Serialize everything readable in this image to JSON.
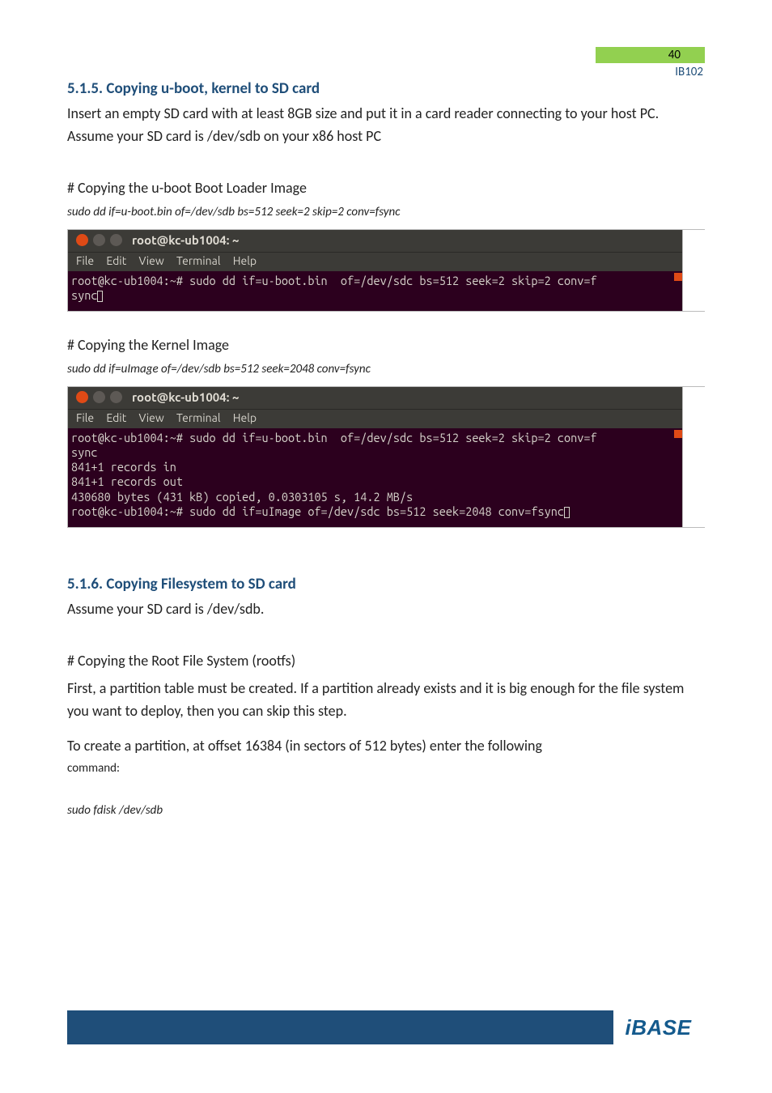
{
  "header": {
    "page_number": "40",
    "model": "IB102"
  },
  "section515": {
    "heading": "5.1.5. Copying u-boot, kernel to SD card",
    "intro": "Insert an empty SD card with at least 8GB size and put it in a card reader connecting to your host PC. Assume your SD card is /dev/sdb on your x86 host PC",
    "sub1_title": "# Copying the u-boot Boot Loader Image",
    "sub1_cmd": "sudo dd if=u-boot.bin    of=/dev/sdb bs=512 seek=2 skip=2 conv=fsync",
    "sub2_title": "# Copying the Kernel Image",
    "sub2_cmd": "sudo dd if=uImage of=/dev/sdb bs=512 seek=2048 conv=fsync"
  },
  "terminal1": {
    "title": "root@kc-ub1004: ~",
    "menu": {
      "file": "File",
      "edit": "Edit",
      "view": "View",
      "terminal": "Terminal",
      "help": "Help"
    },
    "lines": {
      "l1a": "root@kc-ub1004:~# sudo dd if=u-boot.bin  of=/dev/sdc bs=512 seek=2 skip=2 conv=f",
      "l2": "sync"
    }
  },
  "terminal2": {
    "title": "root@kc-ub1004: ~",
    "menu": {
      "file": "File",
      "edit": "Edit",
      "view": "View",
      "terminal": "Terminal",
      "help": "Help"
    },
    "lines": {
      "l1a": "root@kc-ub1004:~# sudo dd if=u-boot.bin  of=/dev/sdc bs=512 seek=2 skip=2 conv=f",
      "l2": "sync",
      "l3": "841+1 records in",
      "l4": "841+1 records out",
      "l5": "430680 bytes (431 kB) copied, 0.0303105 s, 14.2 MB/s",
      "l6": "root@kc-ub1004:~# sudo dd if=uImage of=/dev/sdc bs=512 seek=2048 conv=fsync"
    }
  },
  "section516": {
    "heading": "5.1.6. Copying Filesystem to SD card",
    "intro": "Assume your SD card is /dev/sdb.",
    "sub1_title": "# Copying the Root File System (rootfs)",
    "p1": "First, a partition table must be created. If a partition already exists and it is big enough for the file system you want to deploy, then you can skip this step.",
    "p2": "To create a partition, at offset 16384 (in sectors of 512 bytes) enter the following",
    "p3": "command:",
    "cmd": "sudo fdisk /dev/sdb"
  },
  "footer": {
    "logo": "iBASE"
  }
}
